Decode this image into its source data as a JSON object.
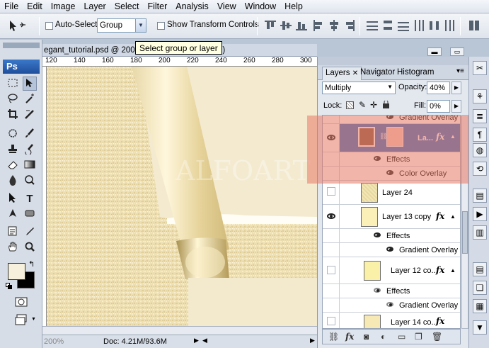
{
  "menu": [
    "File",
    "Edit",
    "Image",
    "Layer",
    "Select",
    "Filter",
    "Analysis",
    "View",
    "Window",
    "Help"
  ],
  "options_bar": {
    "auto_select_label": "Auto-Select:",
    "auto_select_value": "Group",
    "show_transform_label": "Show Transform Controls"
  },
  "tooltip": "Select group or layer",
  "tools": {
    "logo": "Ps"
  },
  "document": {
    "title": "egant_tutorial.psd @ 200",
    "title_suffix": "8)",
    "ruler_ticks": [
      "120",
      "140",
      "160",
      "180",
      "200",
      "220",
      "240",
      "260",
      "280",
      "300"
    ],
    "watermark": "ALFOART",
    "zoom": "200%",
    "doc_size": "Doc: 4.21M/93.6M"
  },
  "layers_panel": {
    "tabs": [
      "Layers",
      "Navigator",
      "Histogram"
    ],
    "blend_mode": "Multiply",
    "opacity_label": "Opacity:",
    "opacity_value": "40%",
    "lock_label": "Lock:",
    "fill_label": "Fill:",
    "fill_value": "0%",
    "rows": {
      "top_partial_effect": "Gradient Overlay",
      "selected_layer_name": "La...",
      "selected_effects": "Effects",
      "selected_effect_1": "Color Overlay",
      "layer24": "Layer 24",
      "layer13": "Layer 13 copy",
      "layer13_effects": "Effects",
      "layer13_effect_1": "Gradient Overlay",
      "layer12": "Layer 12 co...",
      "layer12_effects": "Effects",
      "layer12_effect_1": "Gradient Overlay",
      "layer14": "Layer 14 co..."
    },
    "fx_label": "fx"
  },
  "colors": {
    "foreground": "#f7f0dc",
    "background": "#000000",
    "selection_blue": "#3a6fc1",
    "highlight": "#e87864"
  }
}
